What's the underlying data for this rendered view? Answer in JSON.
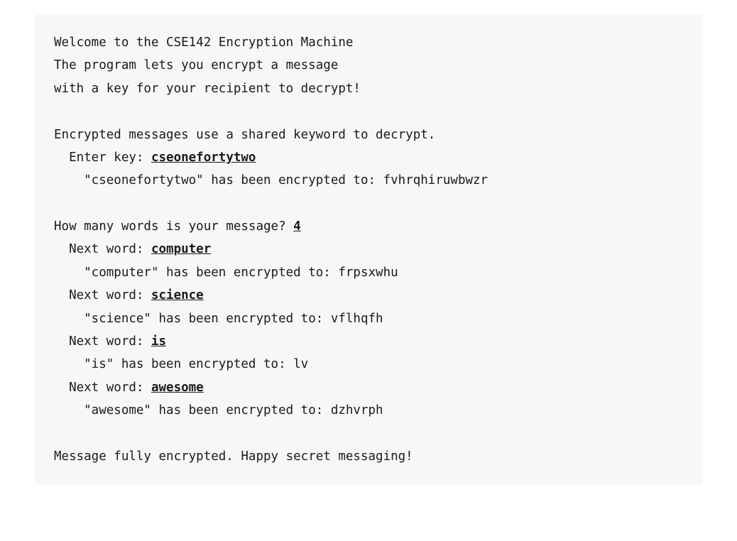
{
  "intro": {
    "line1": "Welcome to the CSE142 Encryption Machine",
    "line2": "The program lets you encrypt a message",
    "line3": "with a key for your recipient to decrypt!"
  },
  "keySection": {
    "prompt": "Encrypted messages use a shared keyword to decrypt.",
    "enterKeyLabel": "  Enter key: ",
    "keyInput": "cseonefortytwo",
    "keyResultPrefix": "    \"cseonefortytwo\" has been encrypted to: ",
    "keyResultValue": "fvhrqhiruwbwzr"
  },
  "wordsSection": {
    "countPrompt": "How many words is your message? ",
    "countInput": "4",
    "words": [
      {
        "label": "  Next word: ",
        "input": "computer",
        "resultLine": "    \"computer\" has been encrypted to: frpsxwhu"
      },
      {
        "label": "  Next word: ",
        "input": "science",
        "resultLine": "    \"science\" has been encrypted to: vflhqfh"
      },
      {
        "label": "  Next word: ",
        "input": "is",
        "resultLine": "    \"is\" has been encrypted to: lv"
      },
      {
        "label": "  Next word: ",
        "input": "awesome",
        "resultLine": "    \"awesome\" has been encrypted to: dzhvrph"
      }
    ]
  },
  "footer": "Message fully encrypted. Happy secret messaging!"
}
